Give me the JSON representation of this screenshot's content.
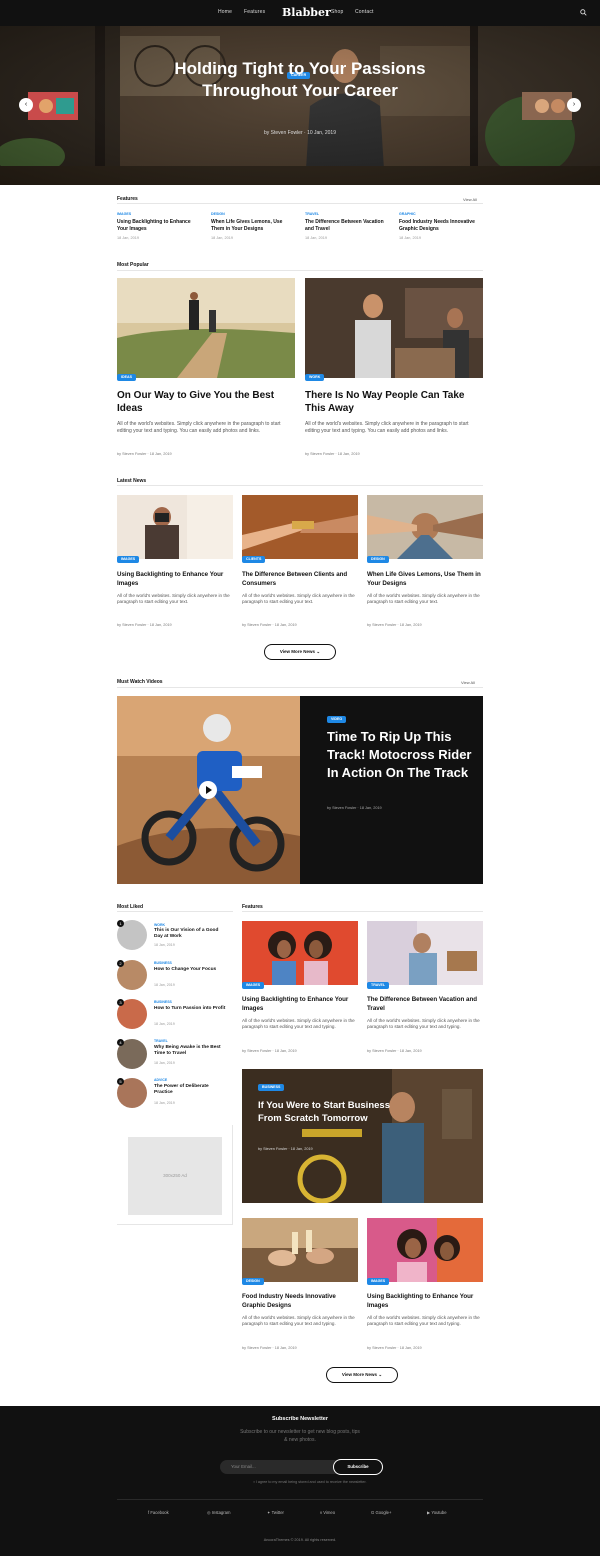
{
  "header": {
    "logo": "Blabber",
    "nav": [
      "Home",
      "Features",
      "Shop",
      "Contact"
    ]
  },
  "hero": {
    "category": "Career",
    "title": "Holding Tight to Your Passions Throughout Your Career",
    "meta": "by Steven Fowler  ·  10 Jan, 2019"
  },
  "features_strip": {
    "title": "Features",
    "link": "View All",
    "items": [
      {
        "cat": "Images",
        "title": "Using Backlighting to Enhance Your Images",
        "date": "18 Jan, 2019"
      },
      {
        "cat": "Design",
        "title": "When Life Gives Lemons, Use Them in Your Designs",
        "date": "18 Jan, 2019"
      },
      {
        "cat": "Travel",
        "title": "The Difference Between Vacation and Travel",
        "date": "18 Jan, 2019"
      },
      {
        "cat": "Graphic",
        "title": "Food Industry Needs Innovative Graphic Designs",
        "date": "18 Jan, 2019"
      }
    ]
  },
  "most_popular": {
    "title": "Most Popular",
    "items": [
      {
        "cat": "Ideas",
        "title": "On Our Way to Give You the Best Ideas",
        "excerpt": "All of the world's websites. Simply click anywhere in the paragraph to start editing your text and typing. You can easily add photos and links.",
        "meta": "by Steven Fowler  ·  18 Jan, 2019"
      },
      {
        "cat": "Work",
        "title": "There Is No Way People Can Take This Away",
        "excerpt": "All of the world's websites. Simply click anywhere in the paragraph to start editing your text and typing. You can easily add photos and links.",
        "meta": "by Steven Fowler  ·  18 Jan, 2019"
      }
    ]
  },
  "latest_news": {
    "title": "Latest News",
    "items": [
      {
        "cat": "Images",
        "title": "Using Backlighting to Enhance Your Images",
        "excerpt": "All of the world's websites. Simply click anywhere in the paragraph to start editing your text.",
        "meta": "by Steven Fowler  ·  18 Jan, 2019"
      },
      {
        "cat": "Clients",
        "title": "The Difference Between Clients and Consumers",
        "excerpt": "All of the world's websites. Simply click anywhere in the paragraph to start editing your text.",
        "meta": "by Steven Fowler  ·  18 Jan, 2019"
      },
      {
        "cat": "Design",
        "title": "When Life Gives Lemons, Use Them in Your Designs",
        "excerpt": "All of the world's websites. Simply click anywhere in the paragraph to start editing your text.",
        "meta": "by Steven Fowler  ·  18 Jan, 2019"
      }
    ],
    "more": "View More News"
  },
  "videos": {
    "title": "Must Watch Videos",
    "link": "View All",
    "cat": "Video",
    "headline": "Time To Rip Up This Track! Motocross Rider In Action On The Track",
    "meta": "by Steven Fowler  ·  18 Jan, 2019"
  },
  "most_liked": {
    "title": "Most Liked",
    "items": [
      {
        "n": "1",
        "cat": "Work",
        "title": "This is Our Vision of a Good Day at Work",
        "date": "18 Jan, 2019"
      },
      {
        "n": "2",
        "cat": "Business",
        "title": "How to Change Your Focus",
        "date": "18 Jan, 2019"
      },
      {
        "n": "3",
        "cat": "Business",
        "title": "How to Turn Passion into Profit",
        "date": "18 Jan, 2019"
      },
      {
        "n": "4",
        "cat": "Travel",
        "title": "Why Being Awake is the Best Time to Travel",
        "date": "18 Jan, 2019"
      },
      {
        "n": "5",
        "cat": "Advice",
        "title": "The Power of Deliberate Practice",
        "date": "18 Jan, 2019"
      }
    ]
  },
  "ad": "300x250 Ad",
  "features_grid": {
    "title": "Features",
    "items": [
      {
        "cat": "Images",
        "title": "Using Backlighting to Enhance Your Images",
        "excerpt": "All of the world's websites. Simply click anywhere in the paragraph to start editing your text and typing.",
        "meta": "by Steven Fowler  ·  18 Jan, 2019"
      },
      {
        "cat": "Travel",
        "title": "The Difference Between Vacation and Travel",
        "excerpt": "All of the world's websites. Simply click anywhere in the paragraph to start editing your text and typing.",
        "meta": "by Steven Fowler  ·  18 Jan, 2019"
      },
      {
        "cat": "Design",
        "title": "Food Industry Needs Innovative Graphic Designs",
        "excerpt": "All of the world's websites. Simply click anywhere in the paragraph to start editing your text and typing.",
        "meta": "by Steven Fowler  ·  18 Jan, 2019"
      },
      {
        "cat": "Images",
        "title": "Using Backlighting to Enhance Your Images",
        "excerpt": "All of the world's websites. Simply click anywhere in the paragraph to start editing your text and typing.",
        "meta": "by Steven Fowler  ·  18 Jan, 2019"
      }
    ],
    "wide": {
      "cat": "Business",
      "title": "If You Were to Start Business From Scratch Tomorrow",
      "meta": "by Steven Fowler  ·  18 Jan, 2019"
    },
    "more": "View More News"
  },
  "footer": {
    "title": "Subscribe Newsletter",
    "sub": "Subscribe to our newsletter to get new blog posts, tips & new photos.",
    "placeholder": "Your Email...",
    "button": "Subscribe",
    "note": "I agree to my email being stored and used to receive the newsletter.",
    "social": [
      "Facebook",
      "Instagram",
      "Twitter",
      "Vimeo",
      "Google+",
      "Youtube"
    ],
    "copyright": "AncoraThemes © 2019. All rights reserved."
  },
  "colors": {
    "accent": "#1e88e5",
    "dark": "#111111"
  }
}
